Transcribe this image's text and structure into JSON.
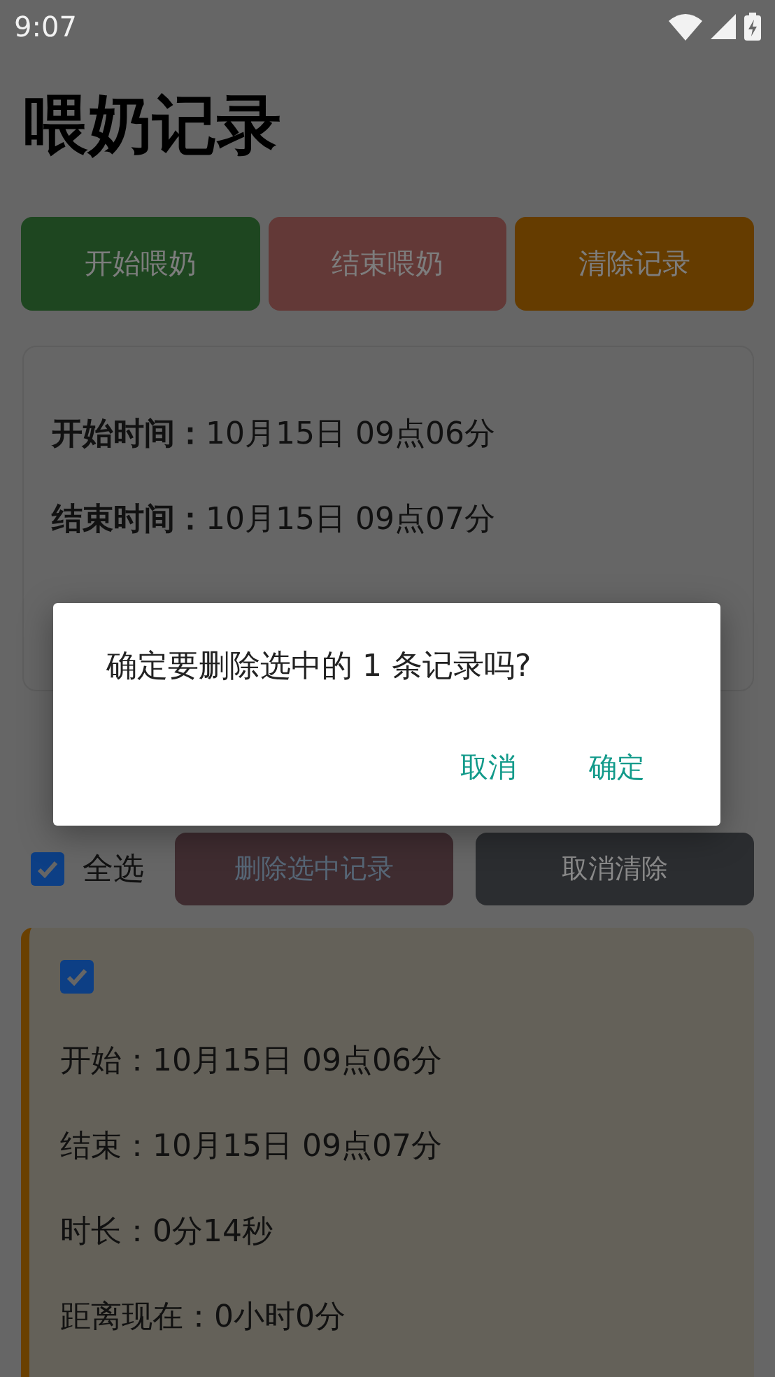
{
  "status_bar": {
    "time": "9:07"
  },
  "title": "喂奶记录",
  "actions": [
    {
      "label": "开始喂奶",
      "kind": "start"
    },
    {
      "label": "结束喂奶",
      "kind": "end"
    },
    {
      "label": "清除记录",
      "kind": "clear"
    }
  ],
  "current": [
    {
      "label": "开始时间：",
      "value": "10月15日 09点06分"
    },
    {
      "label": "结束时间：",
      "value": "10月15日 09点07分"
    }
  ],
  "history": {
    "select_all": {
      "label": "全选",
      "checked": true
    },
    "buttons": [
      {
        "label": "删除选中记录",
        "kind": "delete"
      },
      {
        "label": "取消清除",
        "kind": "cancel"
      }
    ],
    "records": [
      {
        "checked": true,
        "lines": [
          "开始：10月15日 09点06分",
          "结束：10月15日 09点07分",
          "时长：0分14秒",
          "距离现在：0小时0分"
        ]
      }
    ]
  },
  "dialog": {
    "message": "确定要删除选中的 1 条记录吗?",
    "buttons": [
      "取消",
      "确定"
    ]
  }
}
